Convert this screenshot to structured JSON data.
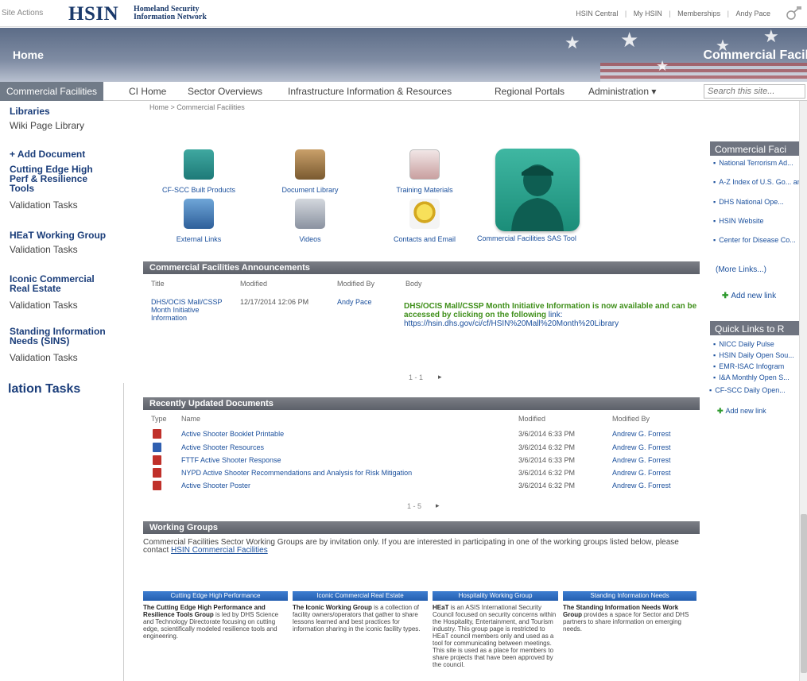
{
  "topbar": {
    "site_label": "Site Actions",
    "logo": "HSIN",
    "logo_sub_line1": "Homeland Security",
    "logo_sub_line2": "Information Network",
    "links": [
      "HSIN Central",
      "My HSIN",
      "Memberships",
      "Andy Pace"
    ]
  },
  "banner": {
    "home": "Home",
    "title": "Commercial Facil"
  },
  "nav": {
    "active_tab": "Commercial Facilities",
    "tabs": [
      "CI Home",
      "Sector Overviews",
      "Infrastructure Information & Resources",
      "Regional Portals",
      "Administration ▾"
    ],
    "search_placeholder": "Search this site..."
  },
  "leftnav": {
    "libraries": "Libraries",
    "wiki": "Wiki Page Library",
    "add_document": "+ Add Document",
    "cutting_edge": [
      "Cutting Edge High",
      "Perf & Resilience",
      "Tools"
    ],
    "validation_tasks": "Validation Tasks",
    "heat_group": "HEaT Working Group",
    "iconic": [
      "Iconic Commercial",
      "Real Estate"
    ],
    "sins": [
      "Standing Information",
      "Needs (SINS)"
    ],
    "big_tasks": "lation Tasks"
  },
  "breadcrumb": "Home > Commercial Facilities",
  "tiles": [
    {
      "label": "CF-SCC Built Products"
    },
    {
      "label": "Document Library"
    },
    {
      "label": "Training Materials"
    },
    {
      "label": "External Links"
    },
    {
      "label": "Videos"
    },
    {
      "label": "Contacts and Email"
    }
  ],
  "bigtile_label": "Commercial Facilities SAS Tool",
  "announcements": {
    "title": "Commercial Facilities Announcements",
    "cols": [
      "Title",
      "Modified",
      "Modified By",
      "Body"
    ],
    "row": {
      "title": "DHS/OCIS Mall/CSSP Month Initiative Information",
      "modified": "12/17/2014 12:06 PM",
      "modified_by": "Andy Pace",
      "body_bold": "DHS/OCIS Mall/CSSP Month Initiative Information is now available and can be accessed by clicking on the following",
      "body_link": "link: https://hsin.dhs.gov/ci/cf/HSIN%20Mall%20Month%20Library"
    },
    "pager": "1 - 1"
  },
  "recent": {
    "title": "Recently Updated Documents",
    "cols": [
      "Type",
      "Name",
      "Modified",
      "Modified By"
    ],
    "rows": [
      {
        "name": "Active Shooter Booklet Printable",
        "modified": "3/6/2014 6:33 PM",
        "by": "Andrew G. Forrest",
        "type": "pdf"
      },
      {
        "name": "Active Shooter Resources",
        "modified": "3/6/2014 6:32 PM",
        "by": "Andrew G. Forrest",
        "type": "doc"
      },
      {
        "name": "FTTF Active Shooter Response",
        "modified": "3/6/2014 6:33 PM",
        "by": "Andrew G. Forrest",
        "type": "pdf"
      },
      {
        "name": "NYPD Active Shooter Recommendations and Analysis for Risk Mitigation",
        "modified": "3/6/2014 6:32 PM",
        "by": "Andrew G. Forrest",
        "type": "pdf"
      },
      {
        "name": "Active Shooter Poster",
        "modified": "3/6/2014 6:32 PM",
        "by": "Andrew G. Forrest",
        "type": "pdf"
      }
    ],
    "pager": "1 - 5"
  },
  "working_groups": {
    "title": "Working Groups",
    "intro": "Commercial Facilities Sector Working Groups are by invitation only. If you are interested in participating in one of the working groups listed below, please contact",
    "intro_link": "HSIN Commercial Facilities",
    "cards": [
      {
        "head": "Cutting Edge High Performance",
        "text_bold": "The Cutting Edge High Performance and Resilience Tools Group",
        "text": " is led by DHS Science and Technology Directorate focusing on cutting edge, scientifically modeled resilience tools and engineering."
      },
      {
        "head": "Iconic Commercial Real Estate",
        "text_bold": "The Iconic Working Group",
        "text": " is a collection of facility owners/operators that gather to share lessons learned and best practices for information sharing in the iconic facility types."
      },
      {
        "head": "Hospitality Working Group",
        "text_bold": "HEaT",
        "text": " is an ASIS International Security Council focused on security concerns within the Hospitality, Entertainment, and Tourism industry. This group page is restricted to HEaT council members only and used as a tool for communicating between meetings. This site is used as a place for members to share projects that have been approved by the council."
      },
      {
        "head": "Standing Information Needs",
        "text_bold": "The Standing Information Needs Work Group",
        "text": " provides a space for Sector and DHS partners to share information on emerging needs."
      }
    ]
  },
  "rail": {
    "cf_head": "Commercial Faci",
    "cf_items": [
      "National Terrorism Ad...",
      "A-Z Index of U.S. Go... and Agencies",
      "DHS National Ope...",
      "HSIN Website",
      "Center for Disease Co..."
    ],
    "more_links": "(More Links...)",
    "add_link": "Add new link",
    "ql_head": "Quick Links to R",
    "ql_items": [
      "NICC Daily Pulse",
      "HSIN Daily Open Sou...",
      "EMR-ISAC Infogram",
      "I&A Monthly Open S...",
      "CF-SCC Daily Open..."
    ],
    "ql_add": "Add new link"
  },
  "colors": {
    "accent": "#1a3d7a",
    "nav_active": "#717b88",
    "panel_header": "#5c6069",
    "green_text": "#3f8f1a",
    "bigtile": "#1b8d79"
  }
}
